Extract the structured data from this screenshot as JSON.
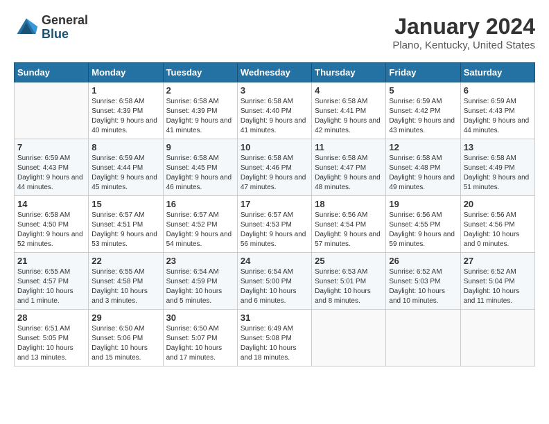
{
  "header": {
    "logo": {
      "general": "General",
      "blue": "Blue"
    },
    "title": "January 2024",
    "location": "Plano, Kentucky, United States"
  },
  "weekdays": [
    "Sunday",
    "Monday",
    "Tuesday",
    "Wednesday",
    "Thursday",
    "Friday",
    "Saturday"
  ],
  "weeks": [
    [
      {
        "day": "",
        "sunrise": "",
        "sunset": "",
        "daylight": ""
      },
      {
        "day": "1",
        "sunrise": "Sunrise: 6:58 AM",
        "sunset": "Sunset: 4:39 PM",
        "daylight": "Daylight: 9 hours and 40 minutes."
      },
      {
        "day": "2",
        "sunrise": "Sunrise: 6:58 AM",
        "sunset": "Sunset: 4:39 PM",
        "daylight": "Daylight: 9 hours and 41 minutes."
      },
      {
        "day": "3",
        "sunrise": "Sunrise: 6:58 AM",
        "sunset": "Sunset: 4:40 PM",
        "daylight": "Daylight: 9 hours and 41 minutes."
      },
      {
        "day": "4",
        "sunrise": "Sunrise: 6:58 AM",
        "sunset": "Sunset: 4:41 PM",
        "daylight": "Daylight: 9 hours and 42 minutes."
      },
      {
        "day": "5",
        "sunrise": "Sunrise: 6:59 AM",
        "sunset": "Sunset: 4:42 PM",
        "daylight": "Daylight: 9 hours and 43 minutes."
      },
      {
        "day": "6",
        "sunrise": "Sunrise: 6:59 AM",
        "sunset": "Sunset: 4:43 PM",
        "daylight": "Daylight: 9 hours and 44 minutes."
      }
    ],
    [
      {
        "day": "7",
        "sunrise": "Sunrise: 6:59 AM",
        "sunset": "Sunset: 4:43 PM",
        "daylight": "Daylight: 9 hours and 44 minutes."
      },
      {
        "day": "8",
        "sunrise": "Sunrise: 6:59 AM",
        "sunset": "Sunset: 4:44 PM",
        "daylight": "Daylight: 9 hours and 45 minutes."
      },
      {
        "day": "9",
        "sunrise": "Sunrise: 6:58 AM",
        "sunset": "Sunset: 4:45 PM",
        "daylight": "Daylight: 9 hours and 46 minutes."
      },
      {
        "day": "10",
        "sunrise": "Sunrise: 6:58 AM",
        "sunset": "Sunset: 4:46 PM",
        "daylight": "Daylight: 9 hours and 47 minutes."
      },
      {
        "day": "11",
        "sunrise": "Sunrise: 6:58 AM",
        "sunset": "Sunset: 4:47 PM",
        "daylight": "Daylight: 9 hours and 48 minutes."
      },
      {
        "day": "12",
        "sunrise": "Sunrise: 6:58 AM",
        "sunset": "Sunset: 4:48 PM",
        "daylight": "Daylight: 9 hours and 49 minutes."
      },
      {
        "day": "13",
        "sunrise": "Sunrise: 6:58 AM",
        "sunset": "Sunset: 4:49 PM",
        "daylight": "Daylight: 9 hours and 51 minutes."
      }
    ],
    [
      {
        "day": "14",
        "sunrise": "Sunrise: 6:58 AM",
        "sunset": "Sunset: 4:50 PM",
        "daylight": "Daylight: 9 hours and 52 minutes."
      },
      {
        "day": "15",
        "sunrise": "Sunrise: 6:57 AM",
        "sunset": "Sunset: 4:51 PM",
        "daylight": "Daylight: 9 hours and 53 minutes."
      },
      {
        "day": "16",
        "sunrise": "Sunrise: 6:57 AM",
        "sunset": "Sunset: 4:52 PM",
        "daylight": "Daylight: 9 hours and 54 minutes."
      },
      {
        "day": "17",
        "sunrise": "Sunrise: 6:57 AM",
        "sunset": "Sunset: 4:53 PM",
        "daylight": "Daylight: 9 hours and 56 minutes."
      },
      {
        "day": "18",
        "sunrise": "Sunrise: 6:56 AM",
        "sunset": "Sunset: 4:54 PM",
        "daylight": "Daylight: 9 hours and 57 minutes."
      },
      {
        "day": "19",
        "sunrise": "Sunrise: 6:56 AM",
        "sunset": "Sunset: 4:55 PM",
        "daylight": "Daylight: 9 hours and 59 minutes."
      },
      {
        "day": "20",
        "sunrise": "Sunrise: 6:56 AM",
        "sunset": "Sunset: 4:56 PM",
        "daylight": "Daylight: 10 hours and 0 minutes."
      }
    ],
    [
      {
        "day": "21",
        "sunrise": "Sunrise: 6:55 AM",
        "sunset": "Sunset: 4:57 PM",
        "daylight": "Daylight: 10 hours and 1 minute."
      },
      {
        "day": "22",
        "sunrise": "Sunrise: 6:55 AM",
        "sunset": "Sunset: 4:58 PM",
        "daylight": "Daylight: 10 hours and 3 minutes."
      },
      {
        "day": "23",
        "sunrise": "Sunrise: 6:54 AM",
        "sunset": "Sunset: 4:59 PM",
        "daylight": "Daylight: 10 hours and 5 minutes."
      },
      {
        "day": "24",
        "sunrise": "Sunrise: 6:54 AM",
        "sunset": "Sunset: 5:00 PM",
        "daylight": "Daylight: 10 hours and 6 minutes."
      },
      {
        "day": "25",
        "sunrise": "Sunrise: 6:53 AM",
        "sunset": "Sunset: 5:01 PM",
        "daylight": "Daylight: 10 hours and 8 minutes."
      },
      {
        "day": "26",
        "sunrise": "Sunrise: 6:52 AM",
        "sunset": "Sunset: 5:03 PM",
        "daylight": "Daylight: 10 hours and 10 minutes."
      },
      {
        "day": "27",
        "sunrise": "Sunrise: 6:52 AM",
        "sunset": "Sunset: 5:04 PM",
        "daylight": "Daylight: 10 hours and 11 minutes."
      }
    ],
    [
      {
        "day": "28",
        "sunrise": "Sunrise: 6:51 AM",
        "sunset": "Sunset: 5:05 PM",
        "daylight": "Daylight: 10 hours and 13 minutes."
      },
      {
        "day": "29",
        "sunrise": "Sunrise: 6:50 AM",
        "sunset": "Sunset: 5:06 PM",
        "daylight": "Daylight: 10 hours and 15 minutes."
      },
      {
        "day": "30",
        "sunrise": "Sunrise: 6:50 AM",
        "sunset": "Sunset: 5:07 PM",
        "daylight": "Daylight: 10 hours and 17 minutes."
      },
      {
        "day": "31",
        "sunrise": "Sunrise: 6:49 AM",
        "sunset": "Sunset: 5:08 PM",
        "daylight": "Daylight: 10 hours and 18 minutes."
      },
      {
        "day": "",
        "sunrise": "",
        "sunset": "",
        "daylight": ""
      },
      {
        "day": "",
        "sunrise": "",
        "sunset": "",
        "daylight": ""
      },
      {
        "day": "",
        "sunrise": "",
        "sunset": "",
        "daylight": ""
      }
    ]
  ]
}
